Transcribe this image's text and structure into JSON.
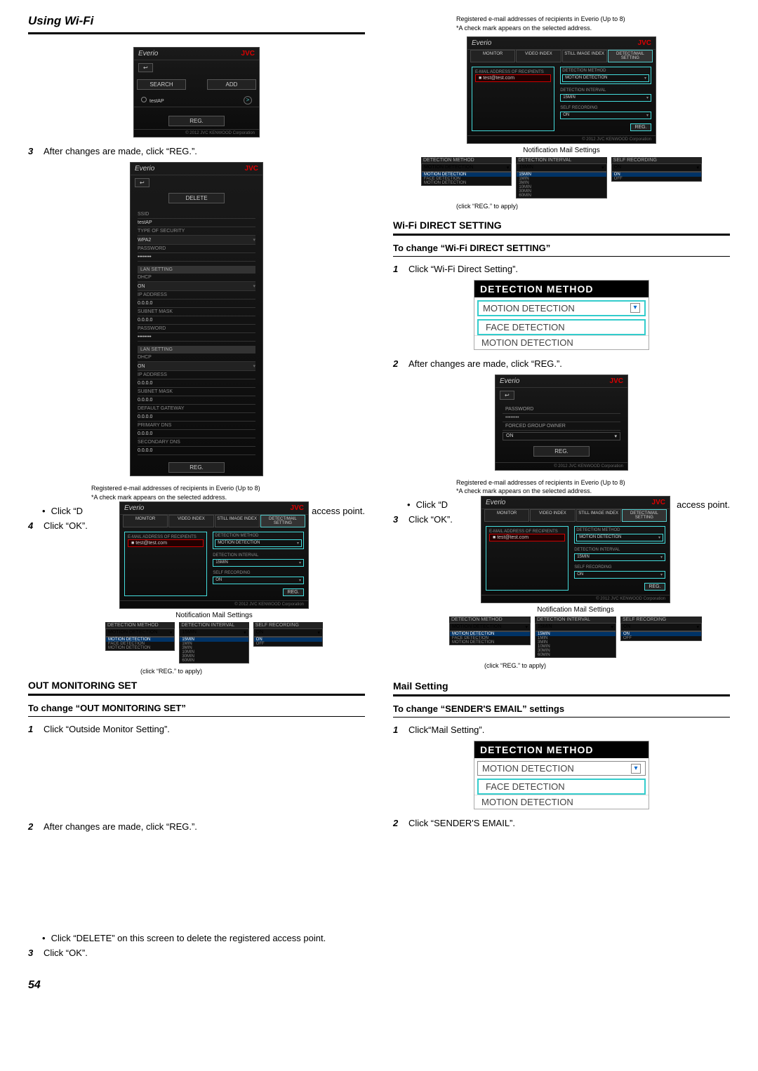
{
  "header": {
    "title": "Using Wi-Fi"
  },
  "text": {
    "after_changes": "After changes are made, click “REG.”.",
    "click_delete": "Click “DELETE” on this screen to delete the registered access point.",
    "click_ok": "Click “OK”.",
    "click_d_partial": "Click “D",
    "access_point_partial": "access point.",
    "click_outside": "Click “Outside Monitor Setting”.",
    "click_wifi_direct": "Click “Wi-Fi Direct Setting”.",
    "click_mail_setting": "Click“Mail Setting”.",
    "click_senders_email": "Click “SENDER'S EMAIL”.",
    "reg_note_a": "Registered e-mail addresses of recipients in Everio (Up to 8)",
    "reg_note_b": "*A check mark appears on the selected address.",
    "notif_caption": "Notification Mail Settings",
    "click_reg_apply": "(click “REG.” to apply)"
  },
  "headings": {
    "out_mon": "OUT MONITORING SET",
    "out_mon_change": "To change “OUT MONITORING SET”",
    "wifi_direct": "Wi-Fi DIRECT SETTING",
    "wifi_direct_change": "To change “Wi-Fi DIRECT SETTING”",
    "mail": "Mail Setting",
    "mail_change": "To change “SENDER'S EMAIL” settings"
  },
  "everio": {
    "brand": "Everio",
    "jvc": "JVC",
    "back": "↩",
    "search": "SEARCH",
    "add": "ADD",
    "reg": "REG.",
    "delete": "DELETE",
    "ap_name": "testAP",
    "foot": "© 2012 JVC KENWOOD Corporation",
    "tabs": [
      "MONITOR",
      "VIDEO INDEX",
      "STILL IMAGE INDEX",
      "DETECT/MAIL SETTING"
    ],
    "labels": {
      "ssid": "SSID",
      "type_sec": "TYPE OF SECURITY",
      "wpa2": "WPA2",
      "password": "PASSWORD",
      "pass_val": "••••••••",
      "lan_setting": "LAN SETTING",
      "dhcp": "DHCP",
      "on": "ON",
      "ip": "IP ADDRESS",
      "subnet": "SUBNET MASK",
      "gateway": "DEFAULT GATEWAY",
      "dns1": "PRIMARY DNS",
      "dns2": "SECONDARY DNS",
      "zeros": "0.0.0.0",
      "forced": "FORCED GROUP OWNER"
    }
  },
  "monitor": {
    "email": "test@test.com",
    "det_method": "DETECTION METHOD",
    "det_interval": "DETECTION INTERVAL",
    "self_rec": "SELF RECORDING",
    "motion": "MOTION DETECTION",
    "face": "FACE DETECTION",
    "intervals": [
      "15MIN",
      "1MIN",
      "3MIN",
      "10MIN",
      "30MIN",
      "60MIN"
    ],
    "on": "ON",
    "off": "OFF"
  },
  "det_fig": {
    "header": "DETECTION METHOD",
    "motion": "MOTION DETECTION",
    "face": "FACE DETECTION"
  },
  "page": "54"
}
